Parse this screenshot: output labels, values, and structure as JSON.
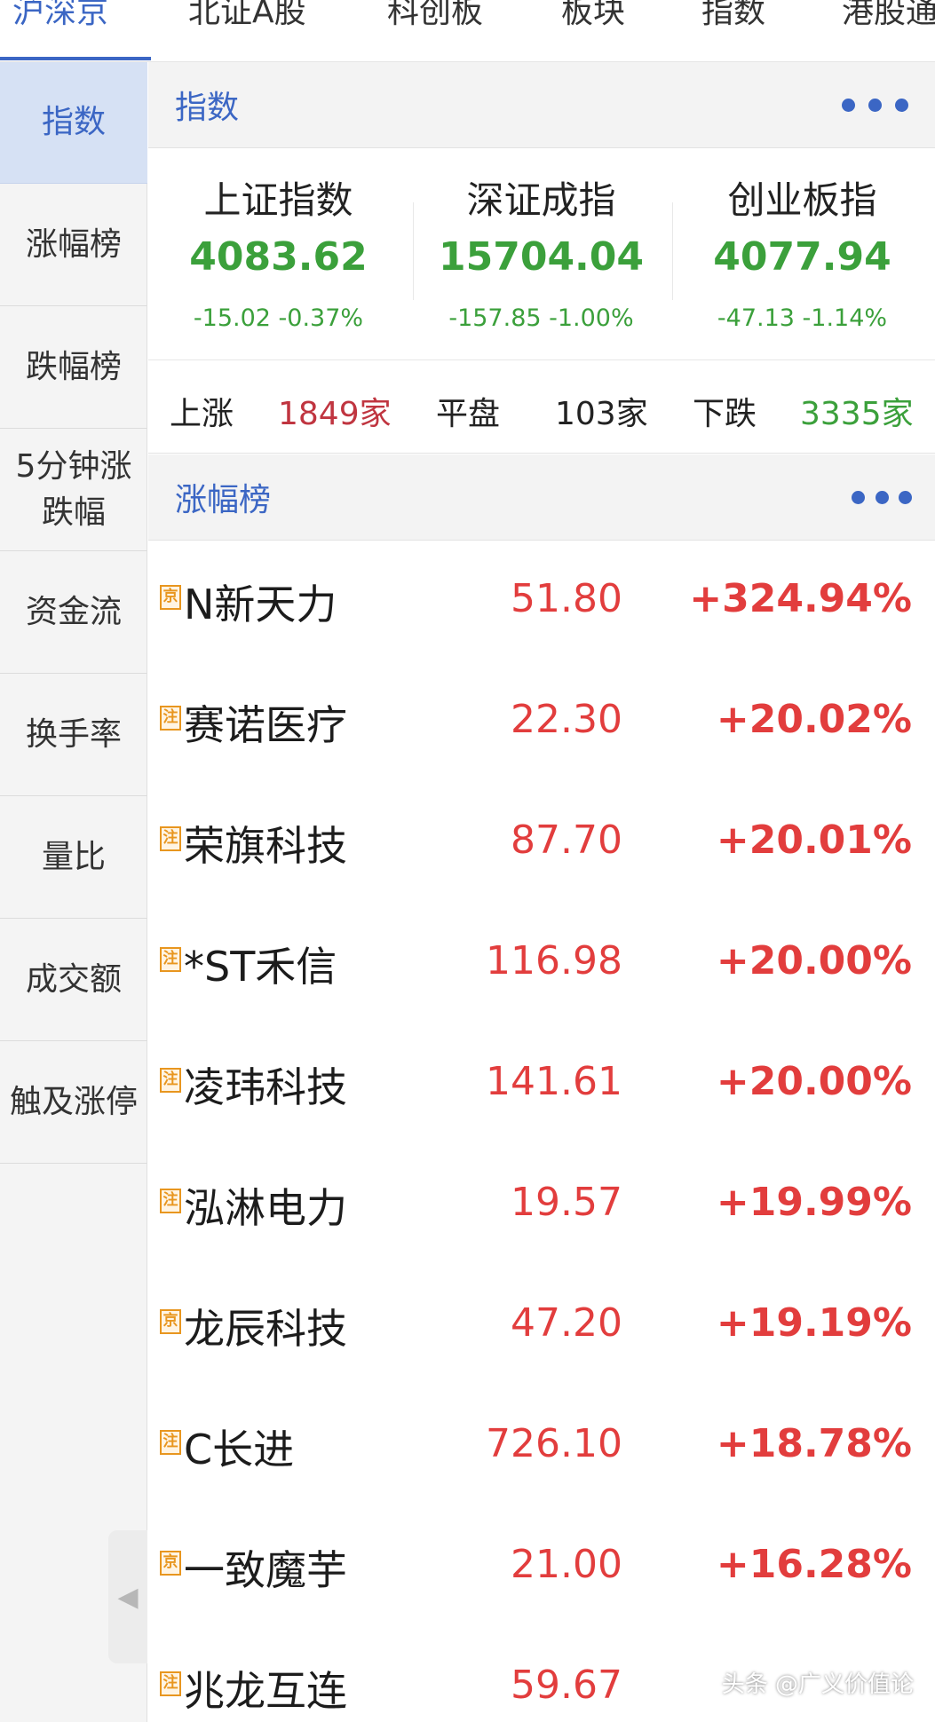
{
  "top_tabs": [
    "沪深京",
    "北证A股",
    "科创板",
    "板块",
    "指数",
    "港股通"
  ],
  "sidebar": {
    "items": [
      {
        "label": "指数"
      },
      {
        "label": "涨幅榜"
      },
      {
        "label": "跌幅榜"
      },
      {
        "label_line1": "5分钟涨",
        "label_line2": "跌幅"
      },
      {
        "label": "资金流"
      },
      {
        "label": "换手率"
      },
      {
        "label": "量比"
      },
      {
        "label": "成交额"
      },
      {
        "label": "触及涨停"
      }
    ]
  },
  "index_section": {
    "title": "指数",
    "indices": [
      {
        "name": "上证指数",
        "price": "4083.62",
        "change": "-15.02 -0.37%"
      },
      {
        "name": "深证成指",
        "price": "15704.04",
        "change": "-157.85 -1.00%"
      },
      {
        "name": "创业板指",
        "price": "4077.94",
        "change": "-47.13 -1.14%"
      }
    ],
    "breadth": {
      "up_label": "上涨",
      "up_count": "1849家",
      "flat_label": "平盘",
      "flat_count": "103家",
      "down_label": "下跌",
      "down_count": "3335家"
    }
  },
  "gainers_section": {
    "title": "涨幅榜",
    "rows": [
      {
        "badge": "京",
        "name": "N新天力",
        "price": "51.80",
        "pct": "+324.94%"
      },
      {
        "badge": "注",
        "name": "赛诺医疗",
        "price": "22.30",
        "pct": "+20.02%"
      },
      {
        "badge": "注",
        "name": "荣旗科技",
        "price": "87.70",
        "pct": "+20.01%"
      },
      {
        "badge": "注",
        "name": "*ST禾信",
        "price": "116.98",
        "pct": "+20.00%"
      },
      {
        "badge": "注",
        "name": "凌玮科技",
        "price": "141.61",
        "pct": "+20.00%"
      },
      {
        "badge": "注",
        "name": "泓淋电力",
        "price": "19.57",
        "pct": "+19.99%"
      },
      {
        "badge": "京",
        "name": "龙辰科技",
        "price": "47.20",
        "pct": "+19.19%"
      },
      {
        "badge": "注",
        "name": "C长进",
        "price": "726.10",
        "pct": "+18.78%"
      },
      {
        "badge": "京",
        "name": "一致魔芋",
        "price": "21.00",
        "pct": "+16.28%"
      },
      {
        "badge": "注",
        "name": "兆龙互连",
        "price": "59.67",
        "pct": ""
      }
    ]
  },
  "watermark": "头条 @广义价值论",
  "colors": {
    "accent": "#3b66c4",
    "up_red": "#e23d3d",
    "down_green": "#3ba03b",
    "badge_orange": "#e8961f"
  }
}
